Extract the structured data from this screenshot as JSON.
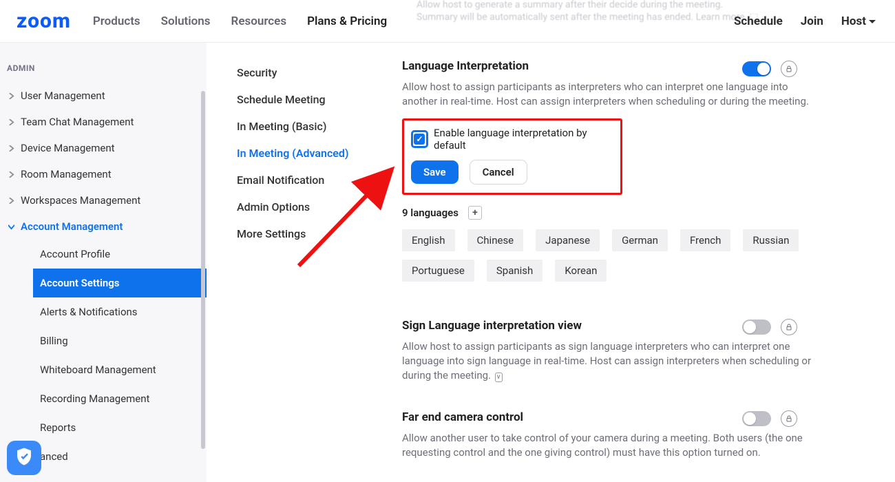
{
  "brand": "zoom",
  "topnav": {
    "items": [
      "Products",
      "Solutions",
      "Resources",
      "Plans & Pricing"
    ],
    "right": {
      "schedule": "Schedule",
      "join": "Join",
      "host": "Host"
    }
  },
  "sidebar": {
    "section": "ADMIN",
    "items": [
      "User Management",
      "Team Chat Management",
      "Device Management",
      "Room Management",
      "Workspaces Management",
      "Account Management"
    ],
    "account_sub": [
      "Account Profile",
      "Account Settings",
      "Alerts & Notifications",
      "Billing",
      "Whiteboard Management",
      "Recording Management",
      "Reports",
      "anced"
    ],
    "active_sub_index": 1
  },
  "tabs": [
    "Security",
    "Schedule Meeting",
    "In Meeting (Basic)",
    "In Meeting (Advanced)",
    "Email Notification",
    "Admin Options",
    "More Settings"
  ],
  "active_tab_index": 3,
  "settings": {
    "lang_interp": {
      "title": "Language Interpretation",
      "desc": "Allow host to assign participants as interpreters who can interpret one language into another in real-time. Host can assign interpreters when scheduling or during the meeting.",
      "toggle_on": true,
      "checkbox_label": "Enable language interpretation by default",
      "save": "Save",
      "cancel": "Cancel",
      "lang_count_label": "9 languages",
      "languages": [
        "English",
        "Chinese",
        "Japanese",
        "German",
        "French",
        "Russian",
        "Portuguese",
        "Spanish",
        "Korean"
      ]
    },
    "sign_lang": {
      "title": "Sign Language interpretation view",
      "desc": "Allow host to assign participants as sign language interpreters who can interpret one language into sign language in real-time. Host can assign interpreters when scheduling or during the meeting.",
      "toggle_on": false
    },
    "far_cam": {
      "title": "Far end camera control",
      "desc": "Allow another user to take control of your camera during a meeting. Both users (the one requesting control and the one giving control) must have this option turned on.",
      "toggle_on": false
    }
  }
}
